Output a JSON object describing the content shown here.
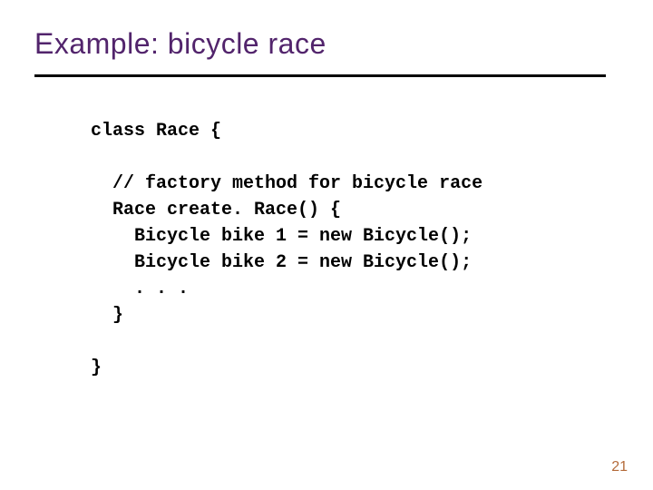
{
  "title": "Example:  bicycle race",
  "code": {
    "l1": "class Race {",
    "l2": "",
    "l3": "  // factory method for bicycle race",
    "l4": "  Race create. Race() {",
    "l5": "    Bicycle bike 1 = new Bicycle();",
    "l6": "    Bicycle bike 2 = new Bicycle();",
    "l7": "    . . .",
    "l8": "  }",
    "l9": "",
    "l10": "}"
  },
  "page_number": "21"
}
